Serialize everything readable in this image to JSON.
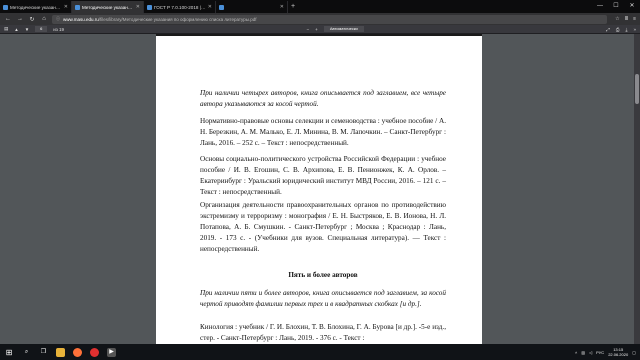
{
  "browser": {
    "tabs": [
      {
        "title": "Методические указания по с...",
        "active": false
      },
      {
        "title": "Методические указания по...",
        "active": true
      },
      {
        "title": "ГОСТ Р 7.0.100-2018 | Страница ...",
        "active": false
      },
      {
        "title": "",
        "active": false
      }
    ],
    "new_tab": "+",
    "window_controls": [
      "—",
      "☐",
      "✕"
    ],
    "url_domain": "www.masu.edu.ru",
    "url_rest": "/files/library/Методические указания по оформлению списка литературы.pdf"
  },
  "pdf_toolbar": {
    "page_current": "6",
    "page_total": "из 19",
    "zoom": "Автоматически"
  },
  "document": {
    "p1": "При наличии четырех авторов, книга описывается под заглавием, все четыре автора указываются за косой чертой.",
    "p2": "Нормативно-правовые основы селекции и семеноводства : учебное пособие / А. Н. Березкин, А. М. Малько, Е. Л. Минина, В. М. Лапочкин. – Санкт-Петербург : Лань, 2016. – 252 с. – Текст : непосредственный.",
    "p3": "Основы социально-политического устройства Российской Федерации : учебное пособие / И. В. Егошин, С. В. Архипова, Е. В. Пенионжек, К. А. Орлов. – Екатеринбург : Уральский юридический институт МВД России, 2016. – 121 с. – Текст : непосредственный.",
    "p4": "Организация деятельности правоохранительных органов по противодействию экстремизму и терроризму : монография / Е. Н. Быстряков, Е. В. Ионова, Н. Л. Потапова, А. Б. Смушкин. - Санкт-Петербург ; Москва ; Краснодар : Лань, 2019. - 173 с. - (Учебники для вузов. Специальная литература). — Текст : непосредственный.",
    "heading": "Пять и более авторов",
    "p5": "При наличии пяти и более авторов, книга описывается под заглавием, за косой чертой приводят фамилии первых трех и в квадратных скобках [и др.].",
    "p6": "Кинология : учебник / Г. И. Блохин, Т. В. Блохина, Г. А. Бурова [и др.]. -5-е изд., стер. - Санкт-Петербург : Лань, 2019. - 376 с. - Текст :"
  },
  "taskbar": {
    "start": "⊞",
    "icons": [
      "search-icon",
      "task-view-icon",
      "explorer-icon",
      "firefox-icon",
      "yandex-icon",
      "media-icon"
    ],
    "time": "13:15",
    "date": "22.06.2020",
    "lang": "РУС"
  },
  "colors": {
    "tab_icon": "#4a90d9",
    "firefox": "#ff7139",
    "yandex": "#e03030"
  }
}
